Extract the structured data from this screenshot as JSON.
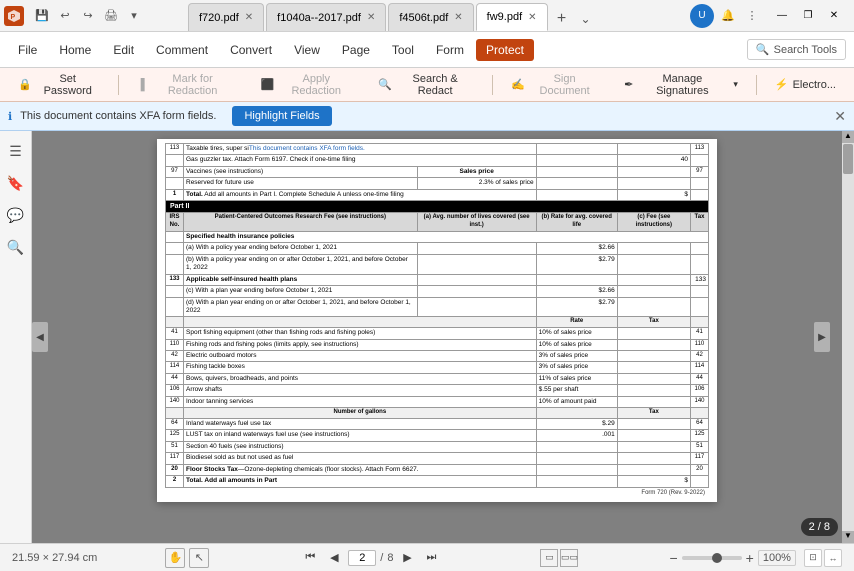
{
  "titleBar": {
    "tabs": [
      {
        "label": "f720.pdf",
        "active": false,
        "id": "tab1"
      },
      {
        "label": "f1040a--2017.pdf",
        "active": false,
        "id": "tab2"
      },
      {
        "label": "f4506t.pdf",
        "active": false,
        "id": "tab3"
      },
      {
        "label": "fw9.pdf",
        "active": true,
        "id": "tab4"
      }
    ],
    "newTabIcon": "+",
    "moreTabsIcon": "⌄",
    "windowControls": [
      "—",
      "❐",
      "✕"
    ]
  },
  "ribbon": {
    "items": [
      {
        "label": "File",
        "active": false
      },
      {
        "label": "Home",
        "active": false
      },
      {
        "label": "Edit",
        "active": false
      },
      {
        "label": "Comment",
        "active": false
      },
      {
        "label": "Convert",
        "active": false
      },
      {
        "label": "View",
        "active": false
      },
      {
        "label": "Page",
        "active": false
      },
      {
        "label": "Tool",
        "active": false
      },
      {
        "label": "Form",
        "active": false
      },
      {
        "label": "Protect",
        "active": true
      }
    ],
    "searchLabel": "Search Tools"
  },
  "toolbar": {
    "buttons": [
      {
        "label": "Set Password",
        "icon": "🔒",
        "disabled": false
      },
      {
        "label": "Mark for Redaction",
        "icon": "✏️",
        "disabled": true
      },
      {
        "label": "Apply Redaction",
        "icon": "⬛",
        "disabled": true
      },
      {
        "label": "Search & Redact",
        "icon": "🔍",
        "disabled": false
      },
      {
        "label": "Sign Document",
        "icon": "✍️",
        "disabled": true
      },
      {
        "label": "Manage Signatures",
        "icon": "✒️",
        "disabled": false,
        "dropdown": true
      },
      {
        "label": "Electro...",
        "icon": "⚡",
        "disabled": false
      }
    ]
  },
  "notification": {
    "text": "This document contains XFA form fields.",
    "buttonLabel": "Highlight Fields",
    "closeIcon": "✕"
  },
  "sidebar": {
    "icons": [
      "☰",
      "🔖",
      "💬",
      "🔍"
    ]
  },
  "document": {
    "rows": [
      {
        "num": "113",
        "description": "Taxable tires, super si...",
        "rate": "",
        "tax": "",
        "irs": "113"
      },
      {
        "num": "",
        "description": "Gas guzzler tax. Attach Form 6197. Check if one-time filing",
        "rate": "",
        "tax": "40",
        "irs": ""
      },
      {
        "num": "97",
        "description": "Vaccines (see instructions)",
        "rate": "Sales price",
        "tax": "",
        "irs": "97"
      },
      {
        "num": "",
        "description": "Reserved for future use",
        "rate": "2.3% of sales price",
        "tax": "",
        "irs": ""
      },
      {
        "num": "1",
        "description": "Total. Add all amounts in Part I. Complete Schedule A unless one-time filing",
        "rate": "",
        "tax": "$",
        "irs": ""
      }
    ],
    "partII": {
      "label": "Part II",
      "headers": [
        "IRS No.",
        "Patient-Centered Outcomes Research Fee (see instructions)",
        "(a) Avg. number of lives covered (see inst.)",
        "(b) Rate for avg. covered life",
        "(c) Fee (see instructions)",
        "Tax",
        "IRS No."
      ],
      "subRows": [
        {
          "label": "Specified health insurance policies"
        },
        {
          "irs": "",
          "desc": "(a) With a policy year ending before October 1, 2021",
          "rate_b": "$2.66",
          "col_c": "",
          "tax": "",
          "irs2": ""
        },
        {
          "irs": "",
          "desc": "(b) With a policy year ending on or after October 1, 2021, and before October 1, 2022",
          "rate_b": "$2.79",
          "col_c": "",
          "tax": "",
          "irs2": ""
        },
        {
          "irs": "133",
          "desc": "Applicable self-insured health plans",
          "rate_b": "",
          "col_c": "",
          "tax": "",
          "irs2": "133"
        },
        {
          "irs": "",
          "desc": "(c) With a plan year ending before October 1, 2021",
          "rate_b": "$2.66",
          "col_c": "",
          "tax": "",
          "irs2": ""
        },
        {
          "irs": "",
          "desc": "(d) With a plan year ending on or after October 1, 2021, and before October 1, 2022",
          "rate_b": "$2.79",
          "col_c": "",
          "tax": "",
          "irs2": ""
        }
      ]
    },
    "exciseTax": {
      "rateHeader": "Rate",
      "taxHeader": "Tax",
      "rows": [
        {
          "irs": "41",
          "desc": "Sport fishing equipment (other than fishing rods and fishing poles)",
          "rate": "10% of sales price",
          "tax": "",
          "irs2": "41"
        },
        {
          "irs": "110",
          "desc": "Fishing rods and fishing poles (limits apply, see instructions)",
          "rate": "10% of sales price",
          "tax": "",
          "irs2": "110"
        },
        {
          "irs": "42",
          "desc": "Electric outboard motors",
          "rate": "3% of sales price",
          "tax": "",
          "irs2": "42"
        },
        {
          "irs": "114",
          "desc": "Fishing tackle boxes",
          "rate": "3% of sales price",
          "tax": "",
          "irs2": "114"
        },
        {
          "irs": "44",
          "desc": "Bows, quivers, broadheads, and points",
          "rate": "11% of sales price",
          "tax": "",
          "irs2": "44"
        },
        {
          "irs": "106",
          "desc": "Arrow shafts",
          "rate": "$.55 per shaft",
          "tax": "",
          "irs2": "106"
        },
        {
          "irs": "140",
          "desc": "Indoor tanning services",
          "rate": "10% of amount paid",
          "tax": "",
          "irs2": "140"
        }
      ]
    },
    "fuelTax": {
      "header": "Number of gallons",
      "taxHeader": "Tax",
      "rows": [
        {
          "irs": "64",
          "desc": "Inland waterways fuel use tax",
          "rate": "$.29",
          "tax": "",
          "irs2": "64"
        },
        {
          "irs": "125",
          "desc": "LUST tax on inland waterways fuel use (see instructions)",
          "rate": ".001",
          "tax": "",
          "irs2": "125"
        },
        {
          "irs": "51",
          "desc": "Section 40 fuels (see instructions)",
          "rate": "",
          "tax": "",
          "irs2": "51"
        },
        {
          "irs": "117",
          "desc": "Biodiesel sold as but not used as fuel",
          "rate": "",
          "tax": "",
          "irs2": "117"
        },
        {
          "irs": "20",
          "desc": "Floor Stocks Tax—Ozone-depleting chemicals (floor stocks). Attach Form 6627.",
          "rate": "",
          "tax": "",
          "irs2": "20"
        }
      ]
    },
    "totalRow": {
      "num": "2",
      "desc": "Total. Add all amounts in Part",
      "tax": "$"
    },
    "footer": "Form 720 (Rev. 9-2022)"
  },
  "bottomBar": {
    "dimensions": "21.59 × 27.94 cm",
    "nav": {
      "firstLabel": "⏮",
      "prevLabel": "◀",
      "currentPage": "2",
      "totalPages": "8",
      "nextLabel": "▶",
      "lastLabel": "⏭"
    },
    "zoom": {
      "minusLabel": "−",
      "plusLabel": "+",
      "percent": "100%"
    },
    "pageBadge": "2 / 8"
  }
}
